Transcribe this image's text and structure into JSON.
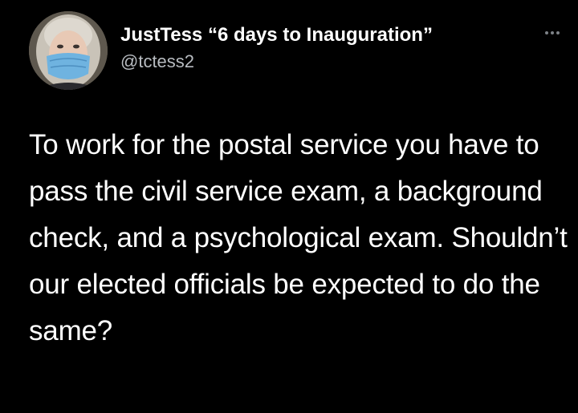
{
  "tweet": {
    "author": {
      "display_name": "JustTess “6 days to Inauguration”",
      "handle": "@tctess2",
      "avatar_icon": "profile-photo-masked-woman"
    },
    "more_icon": "more-options-icon",
    "text": "To work for the postal service you have to pass the civil service exam, a background check, and a psychological exam. Shouldn’t our elected officials be expected to do the same?"
  },
  "colors": {
    "background": "#000000",
    "primary_text": "#ffffff",
    "secondary_text": "#b8bcc1",
    "icon_gray": "#7d8287",
    "mask_blue": "#6fb3e0"
  }
}
